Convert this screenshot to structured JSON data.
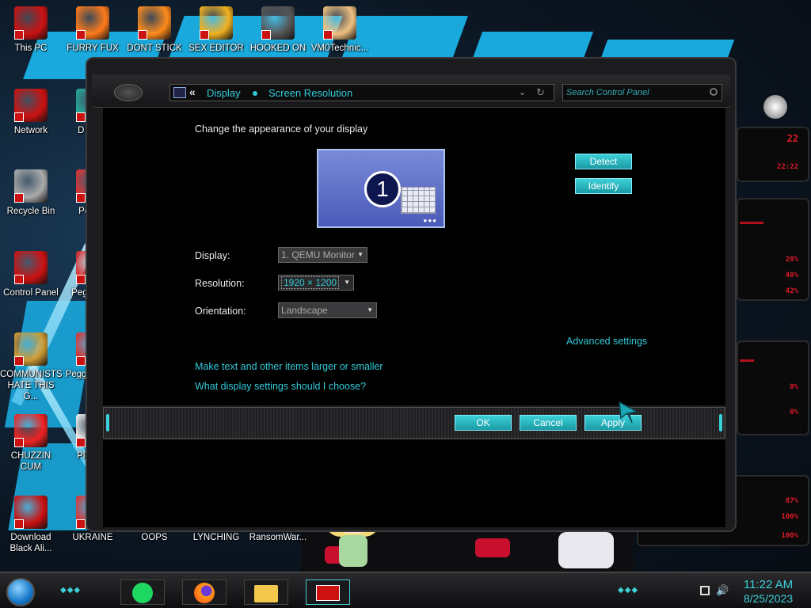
{
  "desktop_icons": [
    {
      "label": "This PC",
      "color": "#c11"
    },
    {
      "label": "FURRY FUX",
      "color": "#ff7a1a"
    },
    {
      "label": "DONT STICK",
      "color": "#ff8a1a"
    },
    {
      "label": "SEX EDITOR",
      "color": "#f0b020"
    },
    {
      "label": "HOOKED ON",
      "color": "#555"
    },
    {
      "label": "VM0Technic...",
      "color": "#f0c080"
    },
    {
      "label": "Network",
      "color": "#c11"
    },
    {
      "label": "D DUM",
      "color": "#2a9"
    },
    {
      "label": "Recycle Bin",
      "color": "#aaa"
    },
    {
      "label": "Peggle",
      "color": "#d33"
    },
    {
      "label": "Control Panel",
      "color": "#c11"
    },
    {
      "label": "Peggle De",
      "color": "#d33"
    },
    {
      "label": "COMMUNISTS HATE THIS G...",
      "color": "#c93"
    },
    {
      "label": "Peggle of Wa",
      "color": "#d33"
    },
    {
      "label": "CHUZZIN CUM",
      "color": "#e22"
    },
    {
      "label": "Plan Zo",
      "color": "#eee"
    },
    {
      "label": "Download Black Ali...",
      "color": "#c11"
    },
    {
      "label": "UKRAINE",
      "color": "#d33"
    },
    {
      "label": "OOPS",
      "color": "#888"
    },
    {
      "label": "LYNCHING",
      "color": "#888"
    },
    {
      "label": "RansomWar...",
      "color": "#888"
    }
  ],
  "address_bar": {
    "back": "«",
    "crumb1": "Display",
    "crumb2": "Screen Resolution",
    "chevron": "⌄",
    "refresh": "↻"
  },
  "search": {
    "placeholder": "Search Control Panel"
  },
  "panel": {
    "heading": "Change the appearance of your display",
    "monitor_number": "1",
    "detect": "Detect",
    "identify": "Identify",
    "display_label": "Display:",
    "display_value": "1. QEMU Monitor",
    "resolution_label": "Resolution:",
    "resolution_value": "1920 × 1200",
    "orientation_label": "Orientation:",
    "orientation_value": "Landscape",
    "advanced_link": "Advanced settings",
    "larger_link": "Make text and other items larger or smaller",
    "choose_link": "What display settings should I choose?"
  },
  "buttons": {
    "ok": "OK",
    "cancel": "Cancel",
    "apply": "Apply"
  },
  "hud": [
    "28%",
    "48%",
    "42%",
    "0%",
    "0%",
    "87%",
    "100%",
    "100%"
  ],
  "clock": {
    "time": "11:22 AM",
    "date": "8/25/2023"
  },
  "colors": {
    "accent": "#33c9d8",
    "hud_red": "#e21a2a"
  },
  "icons": [
    "start-orb-icon",
    "spotify-icon",
    "firefox-icon",
    "file-explorer-icon",
    "control-panel-icon",
    "network-tray-icon",
    "volume-icon"
  ]
}
